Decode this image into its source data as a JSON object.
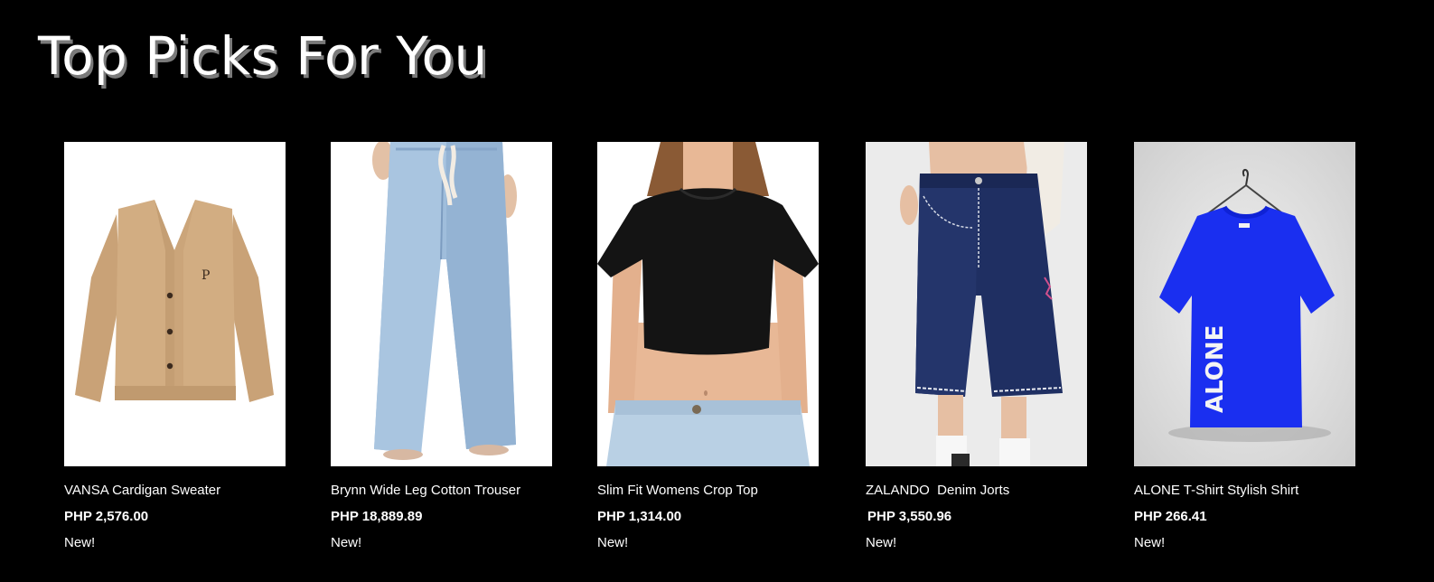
{
  "section": {
    "title": "Top Picks For You"
  },
  "products": [
    {
      "name": "VANSA Cardigan Sweater",
      "price": "PHP 2,576.00",
      "badge": "New!",
      "image_icon": "cardigan-image"
    },
    {
      "name": "Brynn Wide Leg Cotton Trouser",
      "price": "PHP 18,889.89",
      "badge": "New!",
      "image_icon": "trouser-image"
    },
    {
      "name": "Slim Fit Womens Crop Top",
      "price": "PHP 1,314.00",
      "badge": "New!",
      "image_icon": "crop-top-image"
    },
    {
      "name": "ZALANDO  Denim Jorts",
      "price": "PHP 3,550.96",
      "badge": "New!",
      "image_icon": "denim-jorts-image"
    },
    {
      "name": "ALONE T-Shirt Stylish Shirt",
      "price": "PHP 266.41",
      "badge": "New!",
      "image_icon": "tshirt-image"
    }
  ],
  "colors": {
    "background": "#000000",
    "text": "#ffffff",
    "title_shadow": "#7a7a7a"
  }
}
